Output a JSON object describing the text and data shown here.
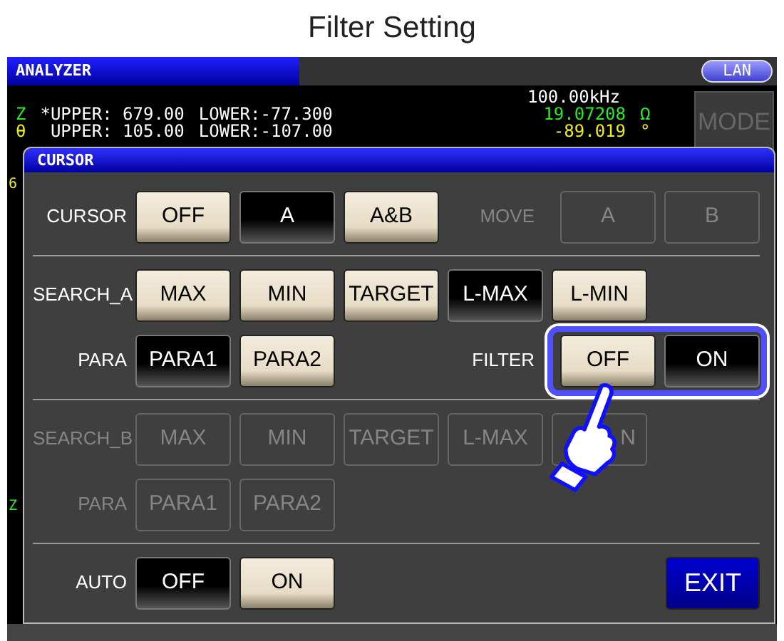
{
  "title": "Filter Setting",
  "header": {
    "title": "ANALYZER",
    "badge": "LAN"
  },
  "measurement": {
    "frequency": "100.00kHz",
    "rows": [
      {
        "param": "Z",
        "color": "#22ee22",
        "upper": "*UPPER: 679.00",
        "lower": "LOWER:-77.300",
        "value": "19.07208",
        "unit": "Ω"
      },
      {
        "param": "θ",
        "color": "#eeee22",
        "upper": " UPPER: 105.00",
        "lower": "LOWER:-107.00",
        "value": "-89.019",
        "unit": "°"
      }
    ]
  },
  "mode_button": {
    "label": "MODE",
    "disabled": true
  },
  "edge_marks": [
    {
      "text": "6",
      "color": "#eeee22"
    },
    {
      "text": "Z",
      "color": "#22ee22"
    }
  ],
  "dialog": {
    "title": "CURSOR",
    "sections": [
      [
        {
          "label": "CURSOR",
          "disabled": false,
          "buttons": [
            {
              "label": "OFF",
              "selected": false,
              "disabled": false
            },
            {
              "label": "A",
              "selected": true,
              "disabled": false
            },
            {
              "label": "A&B",
              "selected": false,
              "disabled": false
            }
          ],
          "extra": {
            "label": "MOVE",
            "disabled": true,
            "buttons": [
              {
                "label": "A",
                "disabled": true
              },
              {
                "label": "B",
                "disabled": true
              }
            ]
          }
        }
      ],
      [
        {
          "label": "SEARCH_A",
          "disabled": false,
          "buttons": [
            {
              "label": "MAX",
              "selected": false,
              "disabled": false
            },
            {
              "label": "MIN",
              "selected": false,
              "disabled": false
            },
            {
              "label": "TARGET",
              "selected": false,
              "disabled": false
            },
            {
              "label": "L-MAX",
              "selected": true,
              "disabled": false
            },
            {
              "label": "L-MIN",
              "selected": false,
              "disabled": false
            }
          ]
        },
        {
          "label": "PARA",
          "disabled": false,
          "buttons": [
            {
              "label": "PARA1",
              "selected": true,
              "disabled": false
            },
            {
              "label": "PARA2",
              "selected": false,
              "disabled": false
            }
          ],
          "extra": {
            "label": "FILTER",
            "disabled": false,
            "highlighted": true,
            "buttons": [
              {
                "label": "OFF",
                "selected": false,
                "disabled": false
              },
              {
                "label": "ON",
                "selected": true,
                "disabled": false
              }
            ]
          }
        }
      ],
      [
        {
          "label": "SEARCH_B",
          "disabled": true,
          "buttons": [
            {
              "label": "MAX",
              "disabled": true
            },
            {
              "label": "MIN",
              "disabled": true
            },
            {
              "label": "TARGET",
              "disabled": true
            },
            {
              "label": "L-MAX",
              "disabled": true
            },
            {
              "label": "N",
              "disabled": true
            }
          ]
        },
        {
          "label": "PARA",
          "disabled": true,
          "buttons": [
            {
              "label": "PARA1",
              "disabled": true
            },
            {
              "label": "PARA2",
              "disabled": true
            }
          ]
        }
      ],
      [
        {
          "label": "AUTO",
          "disabled": false,
          "buttons": [
            {
              "label": "OFF",
              "selected": true,
              "disabled": false
            },
            {
              "label": "ON",
              "selected": false,
              "disabled": false
            }
          ]
        }
      ]
    ],
    "exit": "EXIT"
  }
}
